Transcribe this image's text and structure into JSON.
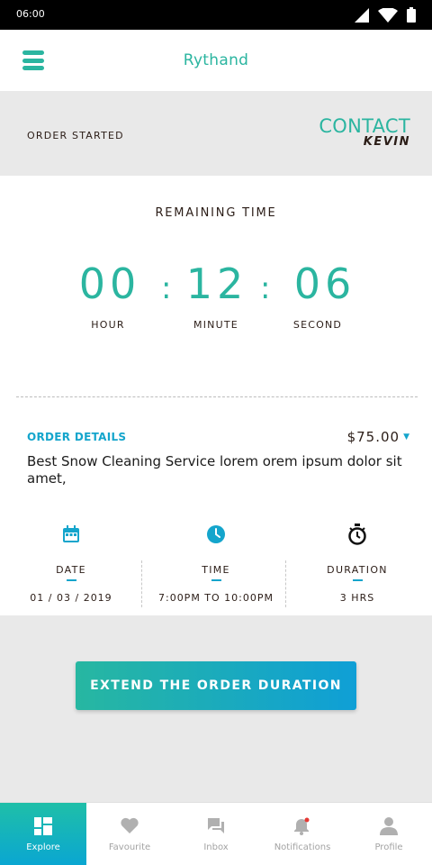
{
  "status_bar": {
    "time": "06:00"
  },
  "app": {
    "title": "Rythand"
  },
  "order_status": {
    "state": "ORDER STARTED",
    "contact_label": "CONTACT",
    "contact_name": "KEVIN"
  },
  "timer": {
    "title": "REMAINING TIME",
    "hour": "00",
    "minute": "12",
    "second": "06",
    "separator": ":",
    "hour_label": "HOUR",
    "minute_label": "MINUTE",
    "second_label": "SECOND"
  },
  "order_details": {
    "title": "ORDER DETAILS",
    "price": "$75.00",
    "description": "Best Snow Cleaning Service lorem orem ipsum dolor sit amet,",
    "date_label": "DATE",
    "date_value": "01 / 03 / 2019",
    "time_label": "TIME",
    "time_value": "7:00PM TO 10:00PM",
    "duration_label": "DURATION",
    "duration_value": "3 HRS"
  },
  "actions": {
    "extend_label": "EXTEND THE ORDER DURATION"
  },
  "bottom_nav": {
    "items": [
      {
        "label": "Explore",
        "icon": "grid-icon",
        "active": true
      },
      {
        "label": "Favourite",
        "icon": "heart-icon",
        "active": false
      },
      {
        "label": "Inbox",
        "icon": "chat-icon",
        "active": false
      },
      {
        "label": "Notifications",
        "icon": "bell-icon",
        "active": false
      },
      {
        "label": "Profile",
        "icon": "person-icon",
        "active": false
      }
    ]
  },
  "colors": {
    "accent": "#2bb5a0",
    "blue": "#14a5cc",
    "notification_dot": "#e53935"
  }
}
